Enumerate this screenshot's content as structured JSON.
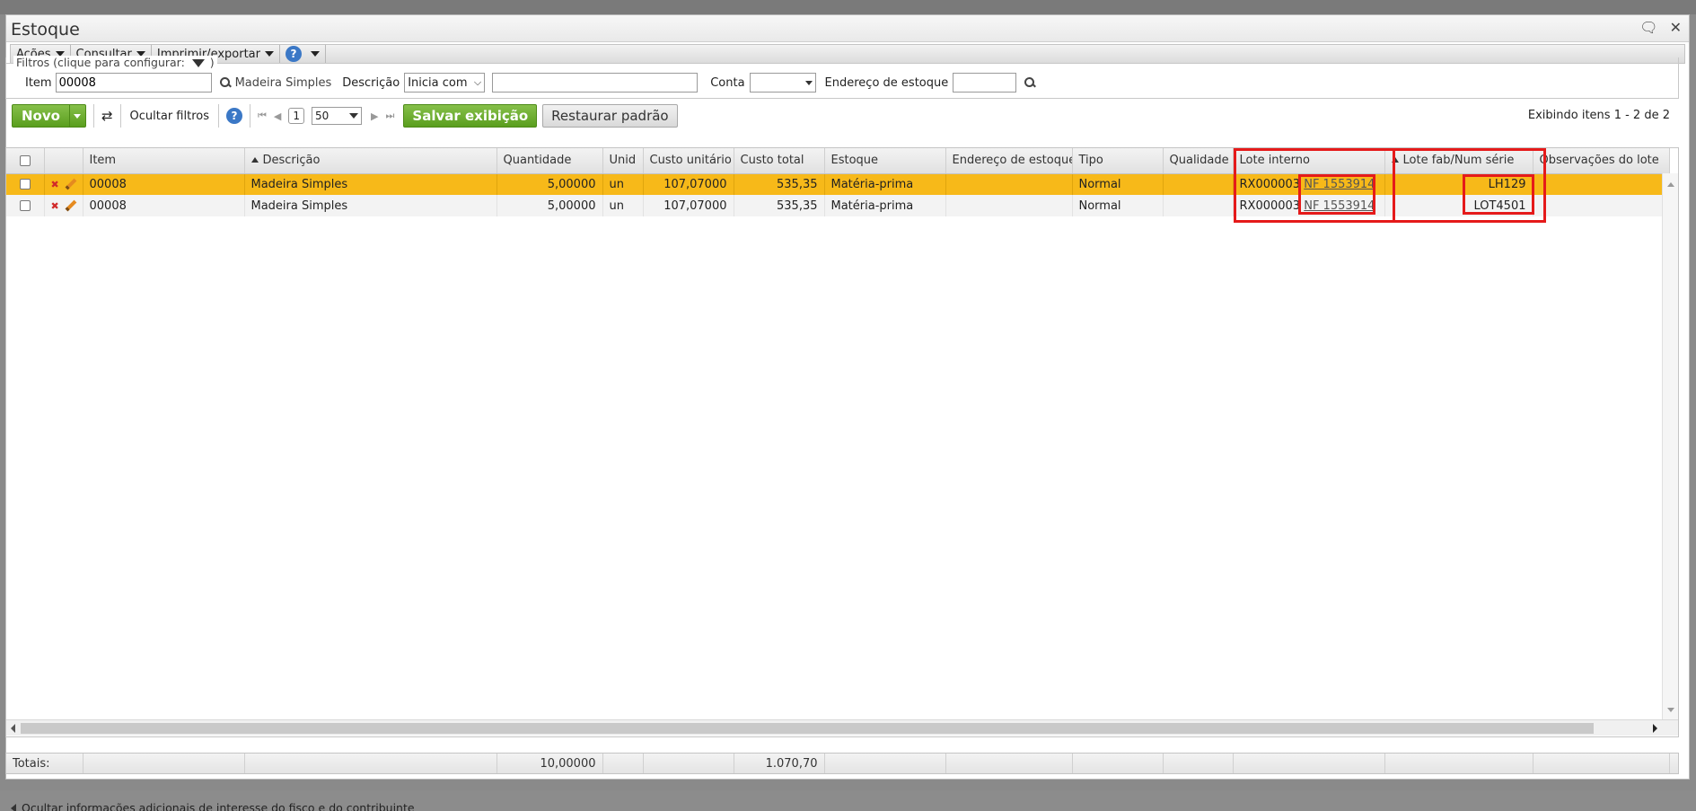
{
  "window": {
    "title": "Estoque"
  },
  "menu": {
    "acoes": "Ações",
    "consultar": "Consultar",
    "imprimir": "Imprimir/exportar",
    "help": "?"
  },
  "filters": {
    "legend": "Filtros (clique para configurar:",
    "legend_end": ")",
    "item_label": "Item",
    "item_value": "00008",
    "item_desc": "Madeira Simples",
    "descricao_label": "Descrição",
    "descricao_mode": "Inicia com",
    "descricao_value": "",
    "conta_label": "Conta",
    "conta_value": "",
    "endereco_label": "Endereço de estoque",
    "endereco_value": ""
  },
  "toolbar": {
    "novo": "Novo",
    "ocultar_filtros": "Ocultar filtros",
    "page": "1",
    "page_size": "50",
    "salvar": "Salvar exibição",
    "restaurar": "Restaurar padrão",
    "exibindo": "Exibindo itens 1 - 2 de 2"
  },
  "columns": [
    "Item",
    "Descrição",
    "Quantidade",
    "Unid",
    "Custo unitário",
    "Custo total",
    "Estoque",
    "Endereço de estoque",
    "Tipo",
    "Qualidade",
    "Lote interno",
    "Lote fab/Num série",
    "Observações do lote"
  ],
  "rows": [
    {
      "item": "00008",
      "descricao": "Madeira Simples",
      "quantidade": "5,00000",
      "unid": "un",
      "custo_unit": "107,07000",
      "custo_total": "535,35",
      "estoque": "Matéria-prima",
      "endereco": "",
      "tipo": "Normal",
      "qualidade": "",
      "lote_interno": "RX000003",
      "lote_link": "NF 1553914",
      "lote_fab": "LH129",
      "obs": ""
    },
    {
      "item": "00008",
      "descricao": "Madeira Simples",
      "quantidade": "5,00000",
      "unid": "un",
      "custo_unit": "107,07000",
      "custo_total": "535,35",
      "estoque": "Matéria-prima",
      "endereco": "",
      "tipo": "Normal",
      "qualidade": "",
      "lote_interno": "RX000003",
      "lote_link": "NF 1553914",
      "lote_fab": "LOT4501",
      "obs": ""
    }
  ],
  "totals": {
    "label": "Totais:",
    "quantidade": "10,00000",
    "custo_total": "1.070,70"
  },
  "footer": {
    "text": "Ocultar informações adicionais de interesse do fisco e do contribuinte"
  },
  "colors": {
    "selected_row": "#f7b919",
    "green_button": "#6aac2c",
    "highlight": "#e51a1a"
  }
}
